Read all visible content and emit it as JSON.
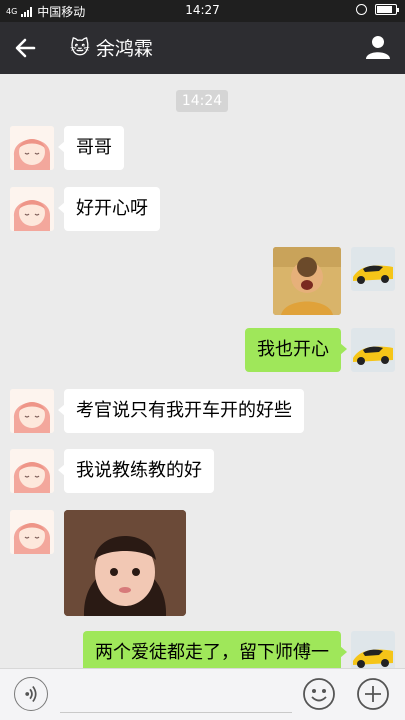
{
  "status_bar": {
    "network": "4G",
    "carrier": "中国移动",
    "time": "14:27"
  },
  "header": {
    "title": "余鸿霖",
    "emoji": "🐱"
  },
  "chat": {
    "timestamp": "14:24",
    "messages": [
      {
        "side": "left",
        "type": "text",
        "text": "哥哥"
      },
      {
        "side": "left",
        "type": "text",
        "text": "好开心呀"
      },
      {
        "side": "right",
        "type": "sticker"
      },
      {
        "side": "right",
        "type": "text",
        "text": "我也开心"
      },
      {
        "side": "left",
        "type": "text",
        "text": "考官说只有我开车开的好些"
      },
      {
        "side": "left",
        "type": "text",
        "text": "我说教练教的好"
      },
      {
        "side": "left",
        "type": "image"
      },
      {
        "side": "right",
        "type": "text",
        "text": "两个爱徒都走了，留下师傅一"
      }
    ]
  },
  "input_bar": {
    "placeholder": ""
  }
}
